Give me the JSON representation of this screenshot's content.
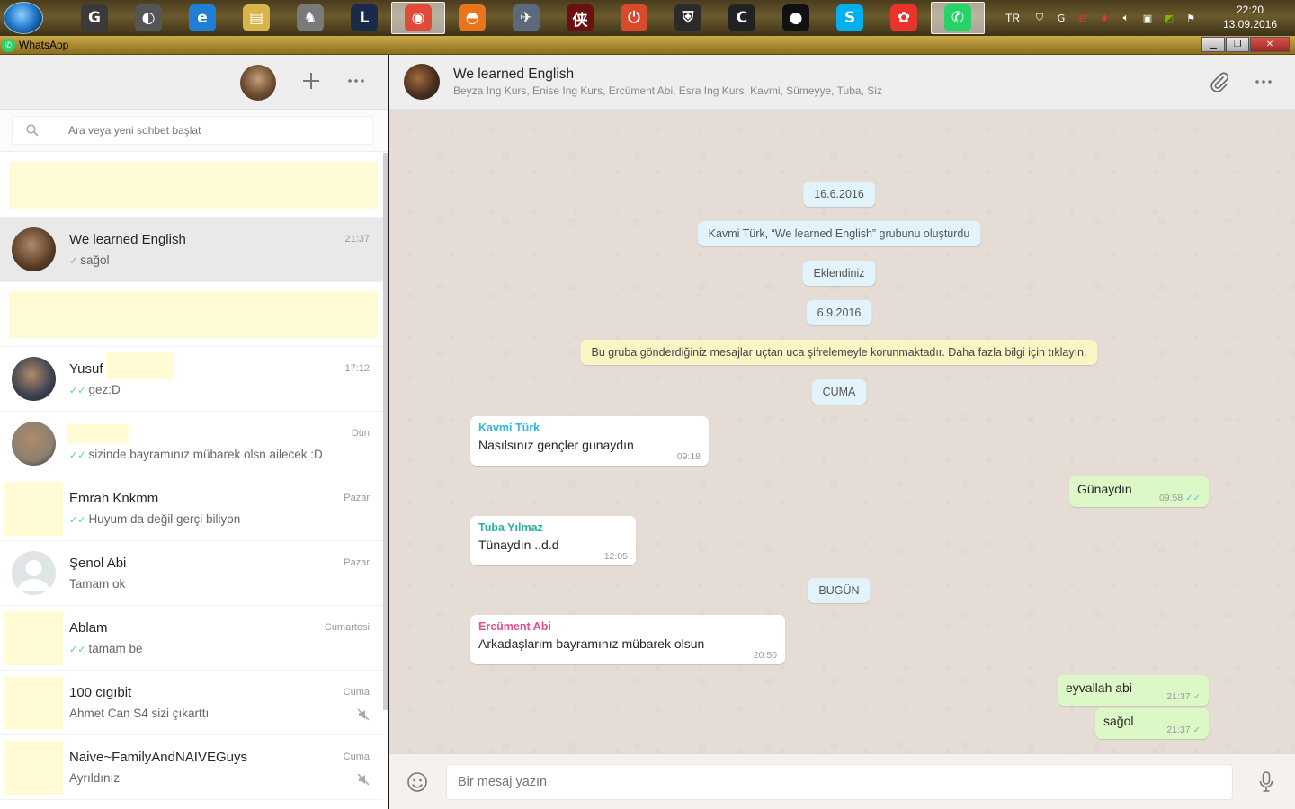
{
  "taskbar": {
    "apps": [
      {
        "icon": "g-icon",
        "glyph": "G",
        "color": "#3a3a3a"
      },
      {
        "icon": "camera-icon",
        "glyph": "◐",
        "color": "#555"
      },
      {
        "icon": "ie-icon",
        "glyph": "e",
        "color": "#1f7fd6"
      },
      {
        "icon": "folder-icon",
        "glyph": "▤",
        "color": "#d9b44a"
      },
      {
        "icon": "dota-icon",
        "glyph": "♞",
        "color": "#7a7a7a"
      },
      {
        "icon": "league-icon",
        "glyph": "L",
        "color": "#1b2a48"
      },
      {
        "icon": "chrome-icon",
        "glyph": "◉",
        "color": "#e04a3a",
        "active": true
      },
      {
        "icon": "firefox-icon",
        "glyph": "◓",
        "color": "#e8741b"
      },
      {
        "icon": "plane-icon",
        "glyph": "✈",
        "color": "#5a6a7a"
      },
      {
        "icon": "game-icon",
        "glyph": "侠",
        "color": "#6b1010"
      },
      {
        "icon": "power-icon",
        "glyph": "⏻",
        "color": "#d84a2a"
      },
      {
        "icon": "shield-game-icon",
        "glyph": "⛨",
        "color": "#2a2a2a"
      },
      {
        "icon": "c-icon",
        "glyph": "C",
        "color": "#222"
      },
      {
        "icon": "record-icon",
        "glyph": "●",
        "color": "#111"
      },
      {
        "icon": "skype-icon",
        "glyph": "S",
        "color": "#00aff0"
      },
      {
        "icon": "paw-icon",
        "glyph": "✿",
        "color": "#e8342a"
      },
      {
        "icon": "whatsapp-icon",
        "glyph": "✆",
        "color": "#25d366",
        "active": true
      }
    ],
    "tray": {
      "lang": "TR",
      "icons": [
        "shield-icon",
        "g-tray-icon",
        "no-entry-icon",
        "flame-icon",
        "volume-icon",
        "network-icon",
        "nvidia-icon",
        "flag-icon"
      ]
    },
    "clock": {
      "time": "22:20",
      "date": "13.09.2016"
    }
  },
  "window": {
    "title": "WhatsApp"
  },
  "search": {
    "placeholder": "Ara veya yeni sohbet başlat"
  },
  "chats": [
    {
      "name": "",
      "time": "",
      "last": "",
      "redacted": true
    },
    {
      "name": "We learned English",
      "time": "21:37",
      "last": "sağol",
      "tick": "single",
      "selected": true,
      "avatar": "#5a3b24"
    },
    {
      "name": "",
      "time": "",
      "last": "",
      "redacted": true
    },
    {
      "name": "Yusuf",
      "time": "17:12",
      "last": "gez:D",
      "tick": "double-blue",
      "avatar": "#3a4150"
    },
    {
      "name": "",
      "time": "Dün",
      "last": "sizinde bayramınız mübarek olsn ailecek :D",
      "tick": "double-blue",
      "avatar": "#8a8070"
    },
    {
      "name": "Emrah Knkmm",
      "time": "Pazar",
      "last": "Huyum da değil gerçi biliyon",
      "tick": "double-blue",
      "avatar": "#fffbd5"
    },
    {
      "name": "Şenol Abi",
      "time": "Pazar",
      "last": "Tamam ok",
      "tick": "",
      "avatar": "default"
    },
    {
      "name": "Ablam",
      "time": "Cumartesi",
      "last": "tamam be",
      "tick": "double-blue",
      "avatar": "#fffbd5"
    },
    {
      "name": "100 cıgıbit",
      "time": "Cuma",
      "last": "Ahmet Can S4 sizi çıkarttı",
      "tick": "",
      "muted": true,
      "avatar": "#fffbd5"
    },
    {
      "name": "Naive~FamilyAndNAIVEGuys",
      "time": "Cuma",
      "last": "Ayrıldınız",
      "tick": "",
      "muted": true,
      "avatar": "#fffbd5"
    }
  ],
  "conversation": {
    "title": "We learned English",
    "members": "Beyza Ing Kurs, Enise Ing Kurs, Ercüment Abi, Esra Ing Kurs, Kavmi, Sümeyye, Tuba, Siz",
    "system": {
      "d1": "16.6.2016",
      "created": "Kavmi Türk, “We learned English” grubunu oluşturdu",
      "added": "Eklendiniz",
      "d2": "6.9.2016",
      "encryption": "Bu gruba gönderdiğiniz mesajlar uçtan uca şifrelemeyle korunmaktadır. Daha fazla bilgi için tıklayın.",
      "d3": "CUMA",
      "d4": "BUGÜN"
    },
    "messages": {
      "m1": {
        "sender": "Kavmi Türk",
        "sender_color": "#35b6e0",
        "text": "Nasılsınız gençler gunaydın",
        "time": "09:18"
      },
      "m2": {
        "text": "Günaydın",
        "time": "09:58"
      },
      "m3": {
        "sender": "Tuba Yılmaz",
        "sender_color": "#2bb39b",
        "text": "Tünaydın ..d.d",
        "time": "12:05"
      },
      "m4": {
        "sender": "Ercüment Abi",
        "sender_color": "#e5508a",
        "text": "Arkadaşlarım bayramınız mübarek olsun",
        "time": "20:50"
      },
      "m5": {
        "text": "eyvallah abi",
        "time": "21:37"
      },
      "m6": {
        "text": "sağol",
        "time": "21:37"
      }
    }
  },
  "compose": {
    "placeholder": "Bir mesaj yazın"
  }
}
